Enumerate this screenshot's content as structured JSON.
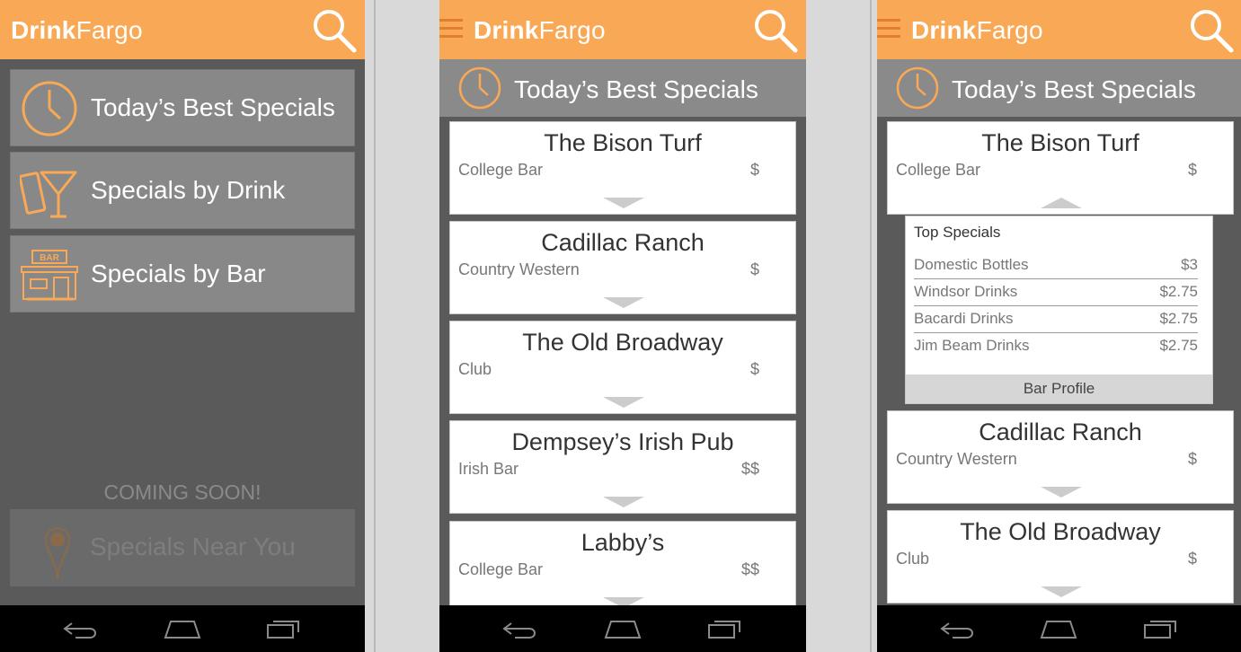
{
  "brand": {
    "bold": "Drink",
    "light": "Fargo"
  },
  "colors": {
    "accent": "#f9a955",
    "accent_dark": "#e27e2e",
    "panel": "#5a5a5a"
  },
  "home": {
    "menu": [
      {
        "label": "Today’s Best Specials",
        "icon": "clock-icon"
      },
      {
        "label": "Specials by Drink",
        "icon": "cocktail-icon"
      },
      {
        "label": "Specials by Bar",
        "icon": "bar-storefront-icon"
      }
    ],
    "coming_soon": "COMING SOON!",
    "near_you": {
      "label": "Specials Near You",
      "icon": "location-pin-icon"
    }
  },
  "list": {
    "header": "Today’s Best Specials",
    "bars": [
      {
        "name": "The Bison Turf",
        "type": "College Bar",
        "price": "$"
      },
      {
        "name": "Cadillac Ranch",
        "type": "Country Western",
        "price": "$"
      },
      {
        "name": "The Old Broadway",
        "type": "Club",
        "price": "$"
      },
      {
        "name": "Dempsey’s Irish Pub",
        "type": "Irish Bar",
        "price": "$$"
      },
      {
        "name": "Labby’s",
        "type": "College Bar",
        "price": "$$"
      }
    ]
  },
  "detail": {
    "top_specials_title": "Top Specials",
    "specials": [
      {
        "name": "Domestic Bottles",
        "price": "$3"
      },
      {
        "name": "Windsor Drinks",
        "price": "$2.75"
      },
      {
        "name": "Bacardi Drinks",
        "price": "$2.75"
      },
      {
        "name": "Jim Beam Drinks",
        "price": "$2.75"
      }
    ],
    "bar_profile": "Bar Profile"
  }
}
